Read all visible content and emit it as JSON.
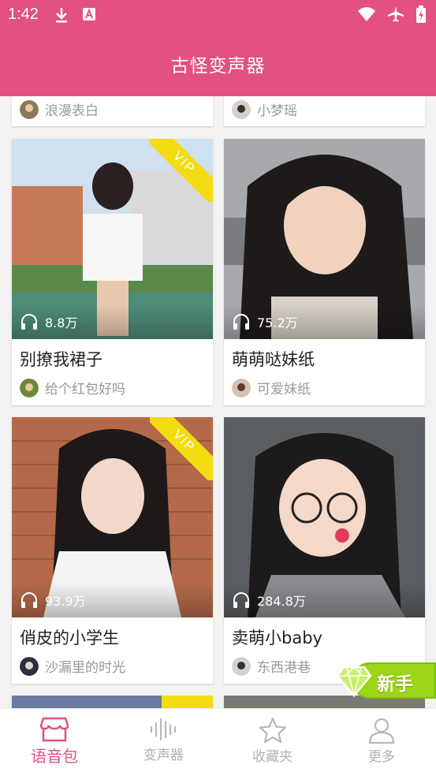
{
  "status_bar": {
    "time": "1:42"
  },
  "header": {
    "title": "古怪变声器"
  },
  "top_partials": [
    {
      "author": "浪漫表白"
    },
    {
      "author": "小梦瑶"
    }
  ],
  "cards": [
    {
      "title": "别撩我裙子",
      "plays": "8.8万",
      "author": "给个红包好吗",
      "vip": "VIP"
    },
    {
      "title": "萌萌哒妹纸",
      "plays": "75.2万",
      "author": "可爱妹纸"
    },
    {
      "title": "俏皮的小学生",
      "plays": "93.9万",
      "author": "沙漏里的时光",
      "vip": "VIP"
    },
    {
      "title": "卖萌小baby",
      "plays": "284.8万",
      "author": "东西港巷"
    }
  ],
  "newbie_badge": "新手",
  "bottom_nav": [
    {
      "label": "语音包",
      "icon": "store-icon"
    },
    {
      "label": "变声器",
      "icon": "waveform-icon"
    },
    {
      "label": "收藏夹",
      "icon": "star-icon"
    },
    {
      "label": "更多",
      "icon": "user-icon"
    }
  ],
  "colors": {
    "accent": "#e2517f",
    "vip": "#f3dc12",
    "newbie": "#9cd416"
  }
}
